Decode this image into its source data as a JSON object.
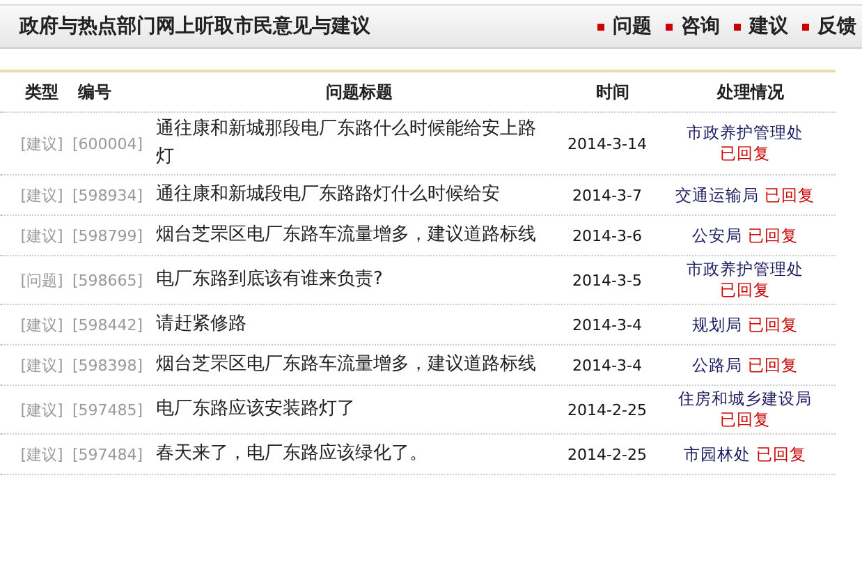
{
  "header": {
    "title": "政府与热点部门网上听取市民意见与建议",
    "nav": [
      "问题",
      "咨询",
      "建议",
      "反馈"
    ]
  },
  "table": {
    "columns": [
      "类型",
      "编号",
      "问题标题",
      "时间",
      "处理情况"
    ],
    "rows": [
      {
        "type": "[建议]",
        "id": "[600004]",
        "title": "通往康和新城那段电厂东路什么时候能给安上路灯",
        "date": "2014-3-14",
        "department": "市政养护管理处",
        "status": "已回复"
      },
      {
        "type": "[建议]",
        "id": "[598934]",
        "title": "通往康和新城段电厂东路路灯什么时候给安",
        "date": "2014-3-7",
        "department": "交通运输局",
        "status": "已回复"
      },
      {
        "type": "[建议]",
        "id": "[598799]",
        "title": "烟台芝罘区电厂东路车流量增多，建议道路标线",
        "date": "2014-3-6",
        "department": "公安局",
        "status": "已回复"
      },
      {
        "type": "[问题]",
        "id": "[598665]",
        "title": "电厂东路到底该有谁来负责?",
        "date": "2014-3-5",
        "department": "市政养护管理处",
        "status": "已回复"
      },
      {
        "type": "[建议]",
        "id": "[598442]",
        "title": "请赶紧修路",
        "date": "2014-3-4",
        "department": "规划局",
        "status": "已回复"
      },
      {
        "type": "[建议]",
        "id": "[598398]",
        "title": "烟台芝罘区电厂东路车流量增多，建议道路标线",
        "date": "2014-3-4",
        "department": "公路局",
        "status": "已回复"
      },
      {
        "type": "[建议]",
        "id": "[597485]",
        "title": "电厂东路应该安装路灯了",
        "date": "2014-2-25",
        "department": "住房和城乡建设局",
        "status": "已回复"
      },
      {
        "type": "[建议]",
        "id": "[597484]",
        "title": "春天来了，电厂东路应该绿化了。",
        "date": "2014-2-25",
        "department": "市园林处",
        "status": "已回复"
      }
    ]
  }
}
